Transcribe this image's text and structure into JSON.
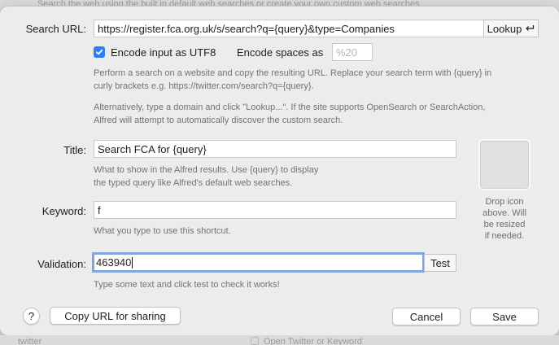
{
  "backdrop": {
    "top_text": "Search the web using the built in default web searches or create your own custom web searches.",
    "bottom_left": "twitter",
    "bottom_right": "Open Twitter or Keyword"
  },
  "search_url": {
    "label": "Search URL:",
    "value": "https://register.fca.org.uk/s/search?q={query}&type=Companies",
    "lookup_label": "Lookup",
    "lookup_icon": "return-key-icon"
  },
  "options": {
    "encode_utf8_label": "Encode input as UTF8",
    "encode_utf8_checked": true,
    "encode_spaces_label": "Encode spaces as",
    "encode_spaces_placeholder": "%20"
  },
  "help": {
    "url_line1": "Perform a search on a website and copy the resulting URL. Replace your search term with {query} in",
    "url_line2": "curly brackets e.g. https://twitter.com/search?q={query}.",
    "lookup_line1": "Alternatively, type a domain and click \"Lookup...\". If the site supports OpenSearch or SearchAction,",
    "lookup_line2": "Alfred will attempt to automatically discover the custom search.",
    "title_line1": "What to show in the Alfred results. Use {query} to display",
    "title_line2": "the typed query like Alfred's default web searches.",
    "keyword": "What you type to use this shortcut.",
    "validation": "Type some text and click test to check it works!"
  },
  "title": {
    "label": "Title:",
    "value": "Search FCA for {query}"
  },
  "keyword": {
    "label": "Keyword:",
    "value": "f"
  },
  "validation": {
    "label": "Validation:",
    "value": "463940",
    "test_label": "Test"
  },
  "icon_drop": {
    "line1": "Drop icon",
    "line2": "above. Will",
    "line3": "be resized",
    "line4": "if needed."
  },
  "footer": {
    "help_label": "?",
    "copy_url_label": "Copy URL for sharing",
    "cancel_label": "Cancel",
    "save_label": "Save"
  },
  "colors": {
    "accent": "#2f7df6",
    "focus_ring": "#7fa6e0",
    "dialog_bg": "#ececec"
  }
}
